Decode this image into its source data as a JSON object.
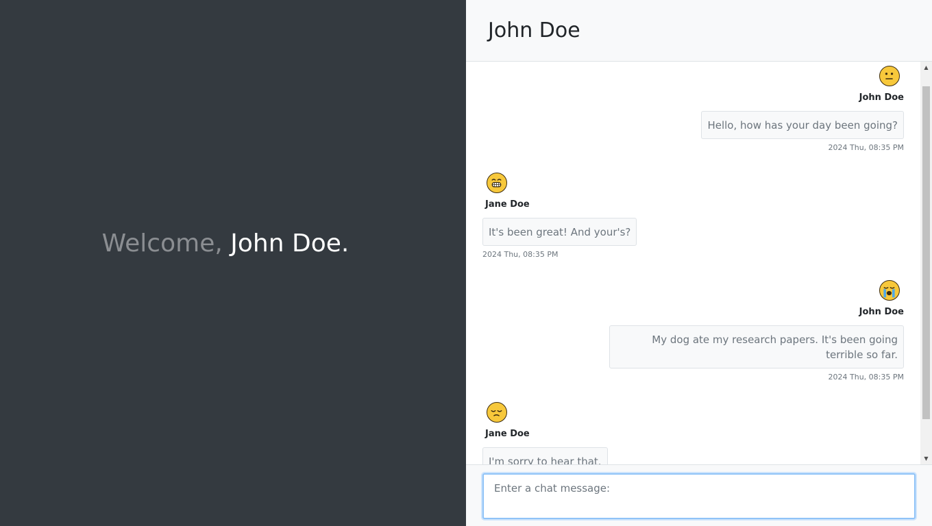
{
  "welcome": {
    "greeting": "Welcome,",
    "name": "John Doe."
  },
  "chat": {
    "title": "John Doe",
    "input_placeholder": "Enter a chat message:",
    "messages": [
      {
        "direction": "outgoing",
        "sender": "John Doe",
        "avatar": "neutral-face-emoji",
        "text": "Hello, how has your day been going?",
        "timestamp": "2024 Thu, 08:35 PM"
      },
      {
        "direction": "incoming",
        "sender": "Jane Doe",
        "avatar": "grinning-face-emoji",
        "text": "It's been great! And your's?",
        "timestamp": "2024 Thu, 08:35 PM"
      },
      {
        "direction": "outgoing",
        "sender": "John Doe",
        "avatar": "crying-face-emoji",
        "text": "My dog ate my research papers. It's been going terrible so far.",
        "timestamp": "2024 Thu, 08:35 PM"
      },
      {
        "direction": "incoming",
        "sender": "Jane Doe",
        "avatar": "pensive-face-emoji",
        "text": "I'm sorry to hear that.",
        "timestamp": ""
      }
    ]
  },
  "colors": {
    "left_pane_bg": "#343a40",
    "header_bg": "#f8f9fa",
    "bubble_bg": "#f8f9fa",
    "emoji_yellow": "#f7c83b",
    "input_focus": "#8fc3f7"
  }
}
